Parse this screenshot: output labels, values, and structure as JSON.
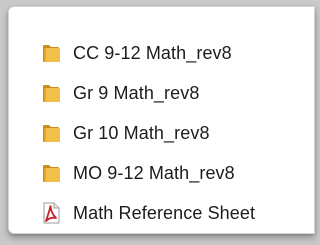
{
  "file_list": {
    "items": [
      {
        "label": "CC 9-12 Math_rev8",
        "type": "folder",
        "icon": "folder-icon"
      },
      {
        "label": "Gr 9 Math_rev8",
        "type": "folder",
        "icon": "folder-icon"
      },
      {
        "label": "Gr 10 Math_rev8",
        "type": "folder",
        "icon": "folder-icon"
      },
      {
        "label": "MO 9-12 Math_rev8",
        "type": "folder",
        "icon": "folder-icon"
      },
      {
        "label": "Math Reference Sheet",
        "type": "pdf",
        "icon": "pdf-icon"
      }
    ]
  },
  "colors": {
    "folder": "#e9b83b",
    "folder_dark": "#c68e1f",
    "pdf_red": "#c8202a"
  }
}
